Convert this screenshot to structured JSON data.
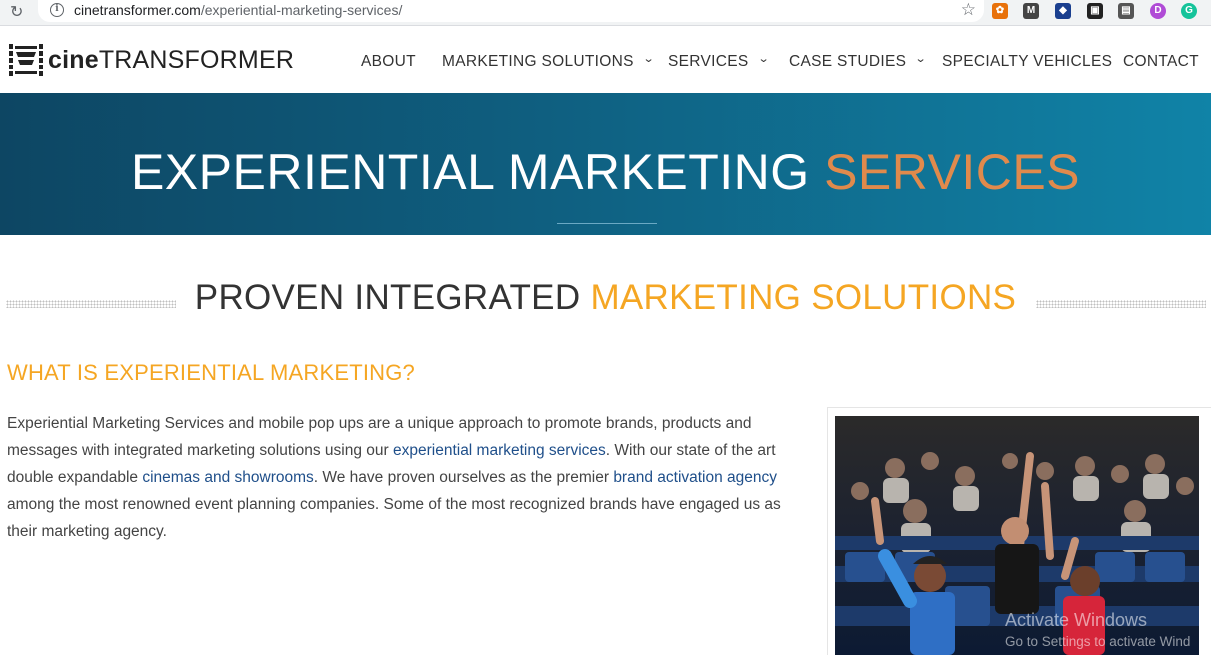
{
  "browser": {
    "url_domain": "cinetransformer.com",
    "url_path": "/experiential-marketing-services/",
    "extensions": [
      {
        "name": "pinwheel-extension-icon",
        "glyph": "✿",
        "color": "#e8710a"
      },
      {
        "name": "gmail-extension-icon",
        "glyph": "M",
        "color": "#444444"
      },
      {
        "name": "shield-extension-icon",
        "glyph": "◆",
        "color": "#1a3f8f"
      },
      {
        "name": "picture-in-picture-extension-icon",
        "glyph": "▣",
        "color": "#222222"
      },
      {
        "name": "window-extension-icon",
        "glyph": "▤",
        "color": "#555555"
      },
      {
        "name": "d-extension-icon",
        "glyph": "D",
        "color": "#b04bd6"
      },
      {
        "name": "grammarly-extension-icon",
        "glyph": "G",
        "color": "#15c39a"
      }
    ]
  },
  "header": {
    "logo_bold": "cine",
    "logo_rest": "TRANSFORMER",
    "nav": [
      {
        "label": "ABOUT",
        "dropdown": false
      },
      {
        "label": "MARKETING SOLUTIONS",
        "dropdown": true
      },
      {
        "label": "SERVICES",
        "dropdown": true
      },
      {
        "label": "CASE STUDIES",
        "dropdown": true
      },
      {
        "label": "SPECIALTY VEHICLES",
        "dropdown": false
      },
      {
        "label": "CONTACT",
        "dropdown": false
      }
    ],
    "chevron": "⌄"
  },
  "hero": {
    "title_main": "EXPERIENTIAL MARKETING ",
    "title_accent": "SERVICES",
    "accent_color": "#e08a4c"
  },
  "section": {
    "title_main": "PROVEN INTEGRATED ",
    "title_accent": "MARKETING SOLUTIONS",
    "subheading": "WHAT IS EXPERIENTIAL MARKETING?",
    "accent_color": "#f5a623",
    "body": [
      {
        "text": "Experiential Marketing Services  and mobile pop ups are a unique approach to promote brands, products and messages with integrated marketing solutions using our ",
        "link": false
      },
      {
        "text": "experiential marketing services",
        "link": true
      },
      {
        "text": ". With our state of the art double expandable ",
        "link": false
      },
      {
        "text": "cinemas and showrooms",
        "link": true
      },
      {
        "text": ". We have proven ourselves as the premier ",
        "link": false
      },
      {
        "text": "brand activation agency",
        "link": true
      },
      {
        "text": " among the most renowned event planning companies. Some of the most recognized brands have engaged us as their marketing agency.",
        "link": false
      }
    ]
  },
  "watermark": {
    "line1": "Activate Windows",
    "line2": "Go to Settings to activate Wind"
  }
}
